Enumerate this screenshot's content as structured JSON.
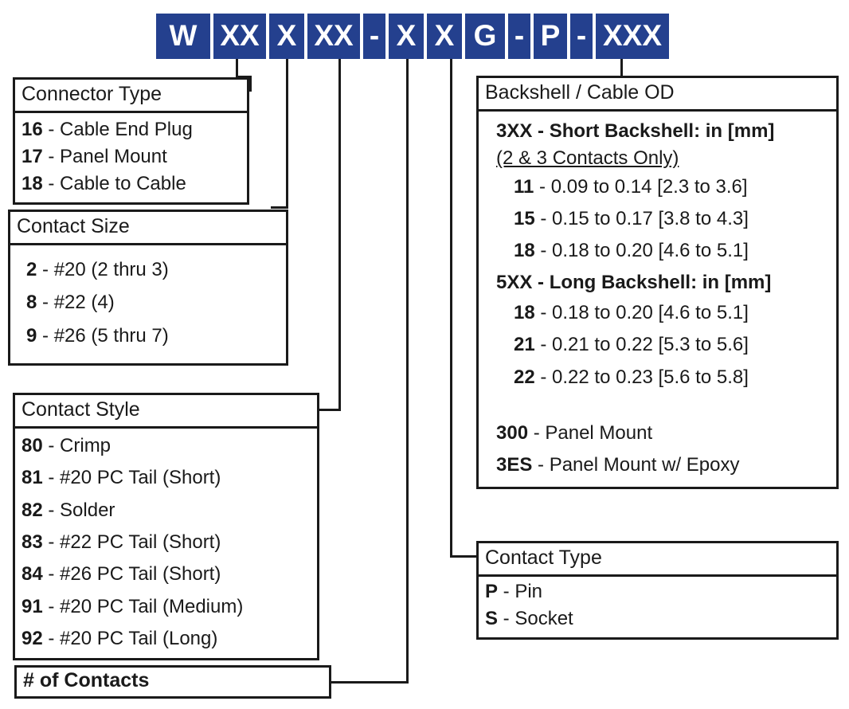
{
  "part_number": {
    "segments": [
      {
        "id": "prefix",
        "text": "W"
      },
      {
        "id": "connector-type",
        "text": "XX"
      },
      {
        "id": "contact-size",
        "text": "X"
      },
      {
        "id": "contact-style",
        "text": "XX"
      },
      {
        "id": "dash-1",
        "text": "-"
      },
      {
        "id": "num-contacts",
        "text": "X"
      },
      {
        "id": "unassigned",
        "text": "X"
      },
      {
        "id": "gold",
        "text": "G"
      },
      {
        "id": "dash-2",
        "text": "-"
      },
      {
        "id": "contact-type",
        "text": "P"
      },
      {
        "id": "dash-3",
        "text": "-"
      },
      {
        "id": "backshell",
        "text": "XXX"
      }
    ]
  },
  "colors": {
    "segment_blue": "#24408E",
    "segment_text": "#FFFFFF",
    "line_black": "#1A1A1A",
    "page_background": "#FFFFFF"
  },
  "boxes": {
    "connector_type": {
      "title": "Connector Type",
      "entries": [
        {
          "code": "16",
          "sep": " - ",
          "desc": "Cable End Plug"
        },
        {
          "code": "17",
          "sep": " - ",
          "desc": "Panel Mount"
        },
        {
          "code": "18",
          "sep": " - ",
          "desc": "Cable to Cable"
        }
      ]
    },
    "contact_size": {
      "title": "Contact Size",
      "entries": [
        {
          "code": "2",
          "sep": " - ",
          "desc": "#20 (2 thru 3)"
        },
        {
          "code": "8",
          "sep": " - ",
          "desc": "#22 (4)"
        },
        {
          "code": "9",
          "sep": " - ",
          "desc": "#26 (5 thru 7)"
        }
      ]
    },
    "contact_style": {
      "title": "Contact Style",
      "entries": [
        {
          "code": "80",
          "sep": " - ",
          "desc": "Crimp"
        },
        {
          "code": "81",
          "sep": " - ",
          "desc": "#20 PC Tail (Short)"
        },
        {
          "code": "82",
          "sep": " - ",
          "desc": "Solder"
        },
        {
          "code": "83",
          "sep": " - ",
          "desc": "#22 PC Tail (Short)"
        },
        {
          "code": "84",
          "sep": " - ",
          "desc": "#26 PC Tail (Short)"
        },
        {
          "code": "91",
          "sep": " - ",
          "desc": "#20 PC Tail (Medium)"
        },
        {
          "code": "92",
          "sep": " - ",
          "desc": "#20 PC Tail (Long)"
        }
      ]
    },
    "num_contacts": {
      "title": "# of Contacts"
    },
    "backshell": {
      "title": "Backshell / Cable OD",
      "short_header": "3XX - Short Backshell: in [mm]",
      "short_note": "(2 & 3 Contacts Only)",
      "short_entries": [
        {
          "code": "11",
          "sep": " - ",
          "desc": "0.09 to 0.14 [2.3 to 3.6]"
        },
        {
          "code": "15",
          "sep": " - ",
          "desc": "0.15 to 0.17 [3.8 to 4.3]"
        },
        {
          "code": "18",
          "sep": " - ",
          "desc": "0.18 to 0.20 [4.6 to 5.1]"
        }
      ],
      "long_header": "5XX - Long Backshell: in [mm]",
      "long_entries": [
        {
          "code": "18",
          "sep": " - ",
          "desc": "0.18 to 0.20 [4.6 to 5.1]"
        },
        {
          "code": "21",
          "sep": " - ",
          "desc": "0.21 to 0.22 [5.3 to 5.6]"
        },
        {
          "code": "22",
          "sep": " - ",
          "desc": "0.22 to 0.23 [5.6 to 5.8]"
        }
      ],
      "panel_entries": [
        {
          "code": "300",
          "sep": " - ",
          "desc": "Panel Mount"
        },
        {
          "code": "3ES",
          "sep": " - ",
          "desc": "Panel Mount w/ Epoxy"
        }
      ]
    },
    "contact_type": {
      "title": "Contact Type",
      "entries": [
        {
          "code": "P",
          "sep": " - ",
          "desc": "Pin"
        },
        {
          "code": "S",
          "sep": " - ",
          "desc": "Socket"
        }
      ]
    }
  }
}
